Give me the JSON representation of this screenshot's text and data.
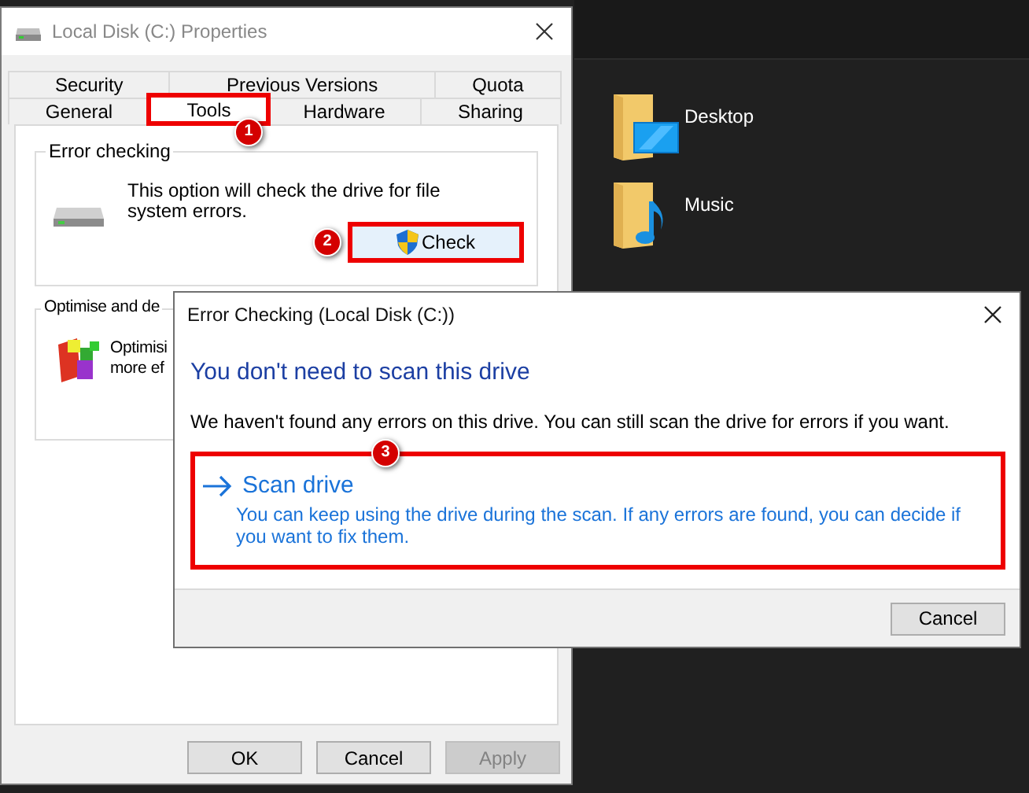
{
  "explorer": {
    "folders": [
      {
        "name": "Desktop",
        "kind": "desktop"
      },
      {
        "name": "Music",
        "kind": "music"
      }
    ]
  },
  "properties": {
    "title": "Local Disk (C:) Properties",
    "tab_rows": [
      [
        {
          "label": "Security",
          "selected": false
        },
        {
          "label": "Previous Versions",
          "selected": false
        },
        {
          "label": "Quota",
          "selected": false
        }
      ],
      [
        {
          "label": "General",
          "selected": false
        },
        {
          "label": "Tools",
          "selected": true,
          "highlighted": true,
          "callout": "1"
        },
        {
          "label": "Hardware",
          "selected": false
        },
        {
          "label": "Sharing",
          "selected": false
        }
      ]
    ],
    "error_checking": {
      "heading": "Error checking",
      "text": "This option will check the drive for file system errors.",
      "button": {
        "label": "Check",
        "highlighted": true,
        "callout": "2"
      }
    },
    "optimise": {
      "heading": "Optimise and de",
      "lines": [
        "Optimisi",
        "more ef"
      ]
    },
    "buttons": [
      {
        "label": "OK",
        "disabled": false
      },
      {
        "label": "Cancel",
        "disabled": false
      },
      {
        "label": "Apply",
        "disabled": true
      }
    ]
  },
  "error_dialog": {
    "title": "Error Checking (Local Disk (C:))",
    "heading": "You don't need to scan this drive",
    "text": "We haven't found any errors on this drive. You can still scan the drive for errors if you want.",
    "action": {
      "title": "Scan drive",
      "description": "You can keep using the drive during the scan. If any errors are found, you can decide if you want to fix them.",
      "highlighted": true,
      "callout": "3"
    },
    "buttons": [
      {
        "label": "Cancel"
      }
    ]
  }
}
